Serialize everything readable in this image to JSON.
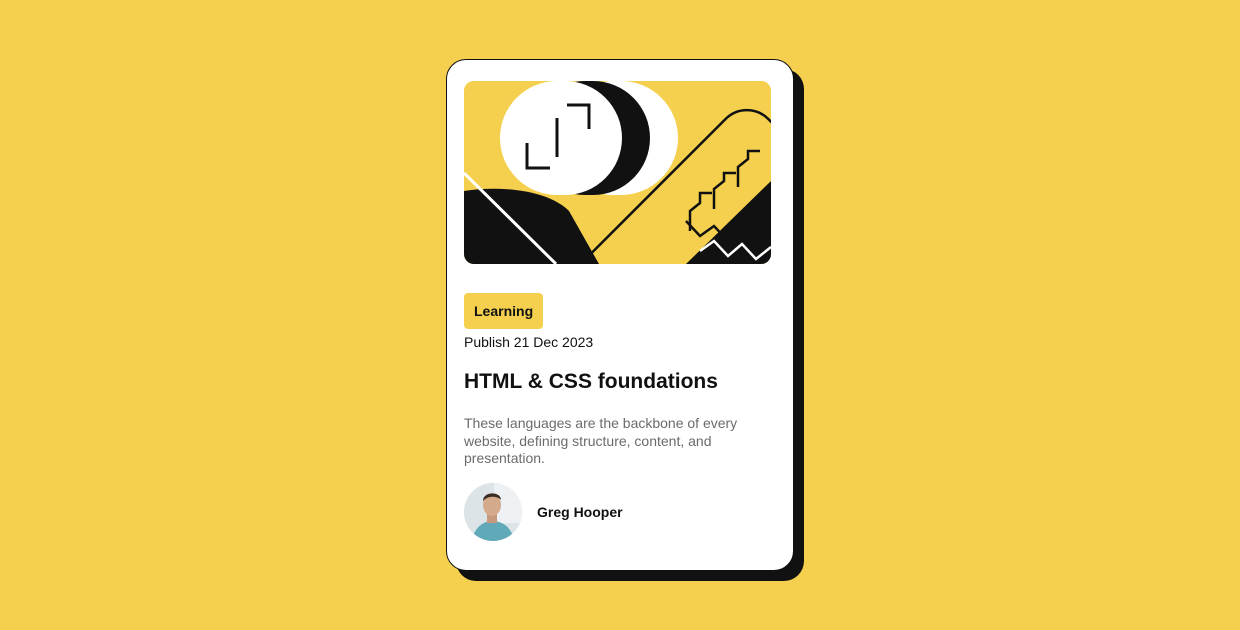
{
  "colors": {
    "page_background": "#F4D04E",
    "card_background": "#FFFFFF",
    "ink": "#111111",
    "tag_background": "#F4D04E",
    "muted_text": "#6B6B6B"
  },
  "card": {
    "hero_image": "abstract-illustration",
    "tag_label": "Learning",
    "publish_date": "Publish 21 Dec 2023",
    "title": "HTML & CSS foundations",
    "description": "These languages are the backbone of every website, defining structure, content, and presentation.",
    "author": {
      "name": "Greg Hooper",
      "avatar": "author-photo"
    }
  }
}
